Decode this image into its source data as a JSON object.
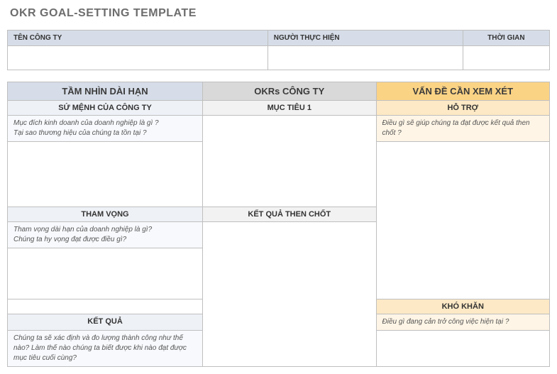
{
  "page_title": "OKR GOAL-SETTING TEMPLATE",
  "info": {
    "company_label": "TÊN CÔNG TY",
    "owner_label": "NGƯỜI THỰC HIỆN",
    "period_label": "THỜI GIAN",
    "company_value": "",
    "owner_value": "",
    "period_value": ""
  },
  "columns": {
    "vision": {
      "header": "TẦM NHÌN DÀI HẠN",
      "mission": {
        "subheader": "SỨ MỆNH CỦA CÔNG TY",
        "prompt": "Mục đích kinh doanh của doanh nghiệp là gì ?\nTại sao thương hiệu của chúng ta tồn tại ?"
      },
      "ambition": {
        "subheader": "THAM VỌNG",
        "prompt": "Tham vọng dài hạn của doanh nghiệp là gì?\nChúng ta hy vọng đạt được điều gì?"
      },
      "result": {
        "subheader": "KẾT QUẢ",
        "prompt": "Chúng ta sẽ xác định và đo lượng thành công như thế nào? Làm thế nào chúng ta biết được khi nào đạt được mục tiêu cuối cùng?"
      }
    },
    "okrs": {
      "header": "OKRs CÔNG TY",
      "objective1": "MỤC TIÊU 1",
      "key_results": "KẾT QUẢ THEN CHỐT"
    },
    "issues": {
      "header": "VẤN ĐỀ CẦN XEM XÉT",
      "support": {
        "subheader": "HỖ TRỢ",
        "prompt": "Điều gì sẽ giúp chúng ta đạt được kết quả then chốt ?"
      },
      "challenge": {
        "subheader": "KHÓ KHĂN",
        "prompt": "Điều gì đang cản trở công việc hiện tại ?"
      }
    }
  }
}
